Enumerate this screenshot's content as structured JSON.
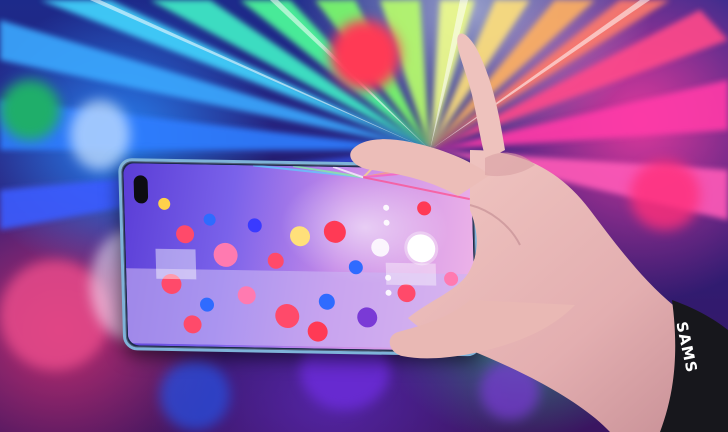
{
  "photo": {
    "wristband_text": "SAMS",
    "colors": {
      "skin": "#e9b8b4",
      "skin_shadow": "#c98f93",
      "phone_frame": "#7fb3d9",
      "wristband": "#17171c"
    },
    "icons": [
      "camera-cutout-icon",
      "shutter-button-icon"
    ]
  }
}
